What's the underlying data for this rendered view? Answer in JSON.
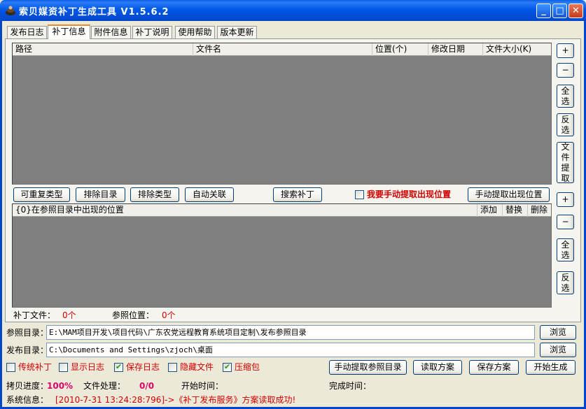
{
  "window": {
    "title": "索贝媒资补丁生成工具 V1.5.6.2",
    "min_glyph": "_",
    "max_glyph": "□",
    "close_glyph": "✕"
  },
  "tabs": [
    "发布日志",
    "补丁信息",
    "附件信息",
    "补丁说明",
    "使用帮助",
    "版本更新"
  ],
  "file_grid": {
    "columns": [
      "路径",
      "文件名",
      "位置(个)",
      "修改日期",
      "文件大小(K)"
    ]
  },
  "side_buttons_top": {
    "add": "+",
    "remove": "−",
    "select_all": "全选",
    "invert": "反选",
    "extract": "文件提取"
  },
  "actions_row": {
    "repeatable_types": "可重复类型",
    "exclude_dirs": "排除目录",
    "exclude_types": "排除类型",
    "auto_link": "自动关联",
    "search_patch": "搜索补丁",
    "manual_extract_check": "我要手动提取出现位置",
    "manual_extract_button": "手动提取出现位置"
  },
  "position_grid": {
    "header": "{0}在参照目录中出现的位置",
    "add": "添加",
    "replace": "替换",
    "delete": "删除"
  },
  "side_buttons_bottom": {
    "add": "+",
    "remove": "−",
    "select_all": "全选",
    "invert": "反选"
  },
  "counts": {
    "patch_files_label": "补丁文件：",
    "patch_files_value": "0个",
    "ref_positions_label": "参照位置：",
    "ref_positions_value": "0个"
  },
  "ref_dir": {
    "label": "参照目录：",
    "value": "E:\\MAM项目开发\\项目代码\\广东农党远程教育系统项目定制\\发布参照目录",
    "browse": "浏览"
  },
  "pub_dir": {
    "label": "发布目录：",
    "value": "C:\\Documents and Settings\\zjoch\\桌面",
    "browse": "浏览"
  },
  "options": [
    {
      "label": "传统补丁",
      "checked": false
    },
    {
      "label": "显示日志",
      "checked": false
    },
    {
      "label": "保存日志",
      "checked": true
    },
    {
      "label": "隐藏文件",
      "checked": false
    },
    {
      "label": "压缩包",
      "checked": true
    }
  ],
  "bottom_buttons": {
    "manual_extract_ref": "手动提取参照目录",
    "read_plan": "读取方案",
    "save_plan": "保存方案",
    "start": "开始生成"
  },
  "status": {
    "copy_progress_label": "拷贝进度：",
    "copy_progress_value": "100%",
    "file_processing_label": "文件处理：",
    "file_processing_value": "0/0",
    "start_time_label": "开始时间：",
    "end_time_label": "完成时间：",
    "system_info_label": "系统信息：",
    "system_info_value": "[2010-7-31 13:24:28:796]->《补丁发布服务》方案读取成功!"
  }
}
